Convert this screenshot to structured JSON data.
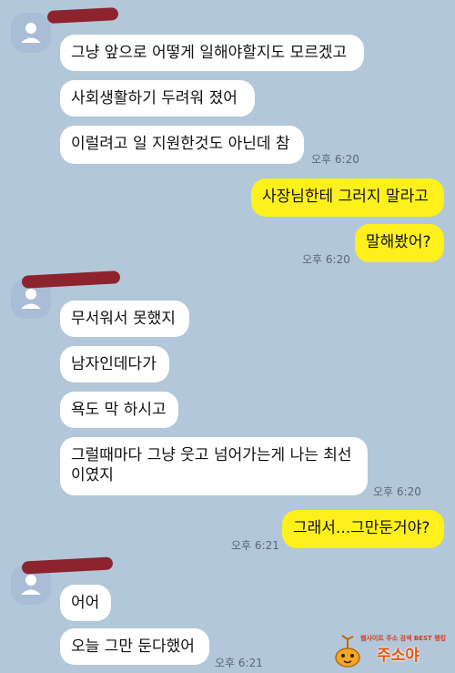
{
  "chat": {
    "messages": [
      {
        "text": "그냥 앞으로 어떻게 일해야할지도 모르겠고"
      },
      {
        "text": "사회생활하기 두려워 졌어"
      },
      {
        "text": "이럴려고 일 지원한것도 아닌데 참",
        "time": "오후 6:20"
      },
      {
        "text": "사장님한테 그러지 말라고"
      },
      {
        "text": "말해봤어?",
        "time": "오후 6:20"
      },
      {
        "text": "무서워서 못했지"
      },
      {
        "text": "남자인데다가"
      },
      {
        "text": "욕도 막 하시고"
      },
      {
        "text": "그럴때마다 그냥 웃고 넘어가는게 나는 최선 이였지",
        "time": "오후 6:20"
      },
      {
        "text": "그래서...그만둔거야?",
        "time": "오후 6:21"
      },
      {
        "text": "어어"
      },
      {
        "text": "오늘 그만 둔다했어",
        "time": "오후 6:21"
      }
    ]
  },
  "watermark": {
    "small_text": "웹사이트 주소 검색 BEST 랭킹",
    "brand_text": "주소야"
  },
  "colors": {
    "background": "#b2c7d9",
    "my_bubble": "#fef01b",
    "their_bubble": "#ffffff",
    "redaction": "#8a1a24"
  }
}
